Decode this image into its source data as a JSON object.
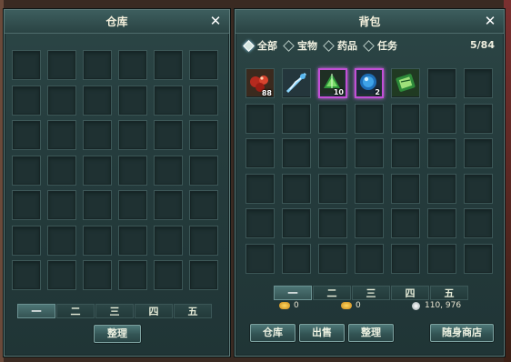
{
  "warehouse": {
    "title": "仓库",
    "close": "✕",
    "tabs": [
      "一",
      "二",
      "三",
      "四",
      "五"
    ],
    "active_tab": 0,
    "sort_button": "整理"
  },
  "bag": {
    "title": "背包",
    "close": "✕",
    "filters": [
      {
        "label": "全部",
        "selected": true
      },
      {
        "label": "宝物",
        "selected": false
      },
      {
        "label": "药品",
        "selected": false
      },
      {
        "label": "任务",
        "selected": false
      }
    ],
    "capacity": "5/84",
    "items": [
      {
        "name": "red-gem-cluster-item",
        "count": "88",
        "border": "none"
      },
      {
        "name": "blue-feather-item",
        "count": "",
        "border": "none"
      },
      {
        "name": "green-wing-item",
        "count": "10",
        "border": "purple"
      },
      {
        "name": "blue-orb-item",
        "count": "2",
        "border": "purple"
      },
      {
        "name": "green-scroll-item",
        "count": "",
        "border": "none"
      }
    ],
    "tabs": [
      "一",
      "二",
      "三",
      "四",
      "五"
    ],
    "active_tab": 0,
    "currency": {
      "gold_bound": "0",
      "gold": "0",
      "silver": "110, 976"
    },
    "buttons": {
      "warehouse": "仓库",
      "sell": "出售",
      "sort": "整理",
      "portable_shop": "随身商店"
    }
  },
  "colors": {
    "panel": "#253c3d",
    "slot": "#1f3132",
    "purple_border": "#c24fd6",
    "active_tab": "#4d7575"
  }
}
